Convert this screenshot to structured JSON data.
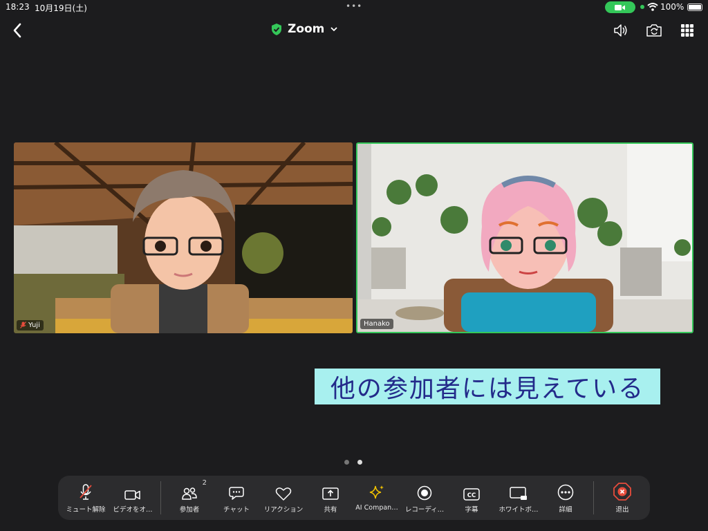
{
  "status_bar": {
    "time": "18:23",
    "date": "10月19日(土)",
    "battery": "100%"
  },
  "top_bar": {
    "meeting_title": "Zoom",
    "icons": [
      "back-chevron-icon",
      "shield-check-icon",
      "chevron-down-icon",
      "speaker-icon",
      "switch-camera-icon",
      "grid-view-icon"
    ],
    "accent_color": "#34c759"
  },
  "participants": [
    {
      "name": "Yuji",
      "muted": true
    },
    {
      "name": "Hanako",
      "muted": false,
      "active_speaker": true
    }
  ],
  "caption_text": "他の参加者には見えている",
  "toolbar": {
    "items": [
      {
        "id": "mute",
        "label": "ミュート解除",
        "icon": "mic-off-icon"
      },
      {
        "id": "video",
        "label": "ビデオをオ…",
        "icon": "video-camera-icon"
      },
      {
        "id": "participants",
        "label": "参加者",
        "icon": "participants-icon",
        "badge": "2"
      },
      {
        "id": "chat",
        "label": "チャット",
        "icon": "chat-icon"
      },
      {
        "id": "reaction",
        "label": "リアクション",
        "icon": "heart-icon"
      },
      {
        "id": "share",
        "label": "共有",
        "icon": "share-screen-icon"
      },
      {
        "id": "ai",
        "label": "AI Compan…",
        "icon": "sparkle-icon"
      },
      {
        "id": "record",
        "label": "レコーディ…",
        "icon": "record-icon"
      },
      {
        "id": "cc",
        "label": "字幕",
        "icon": "closed-caption-icon"
      },
      {
        "id": "whiteboard",
        "label": "ホワイトボ…",
        "icon": "whiteboard-icon"
      },
      {
        "id": "more",
        "label": "詳細",
        "icon": "more-icon"
      },
      {
        "id": "leave",
        "label": "退出",
        "icon": "leave-icon"
      }
    ]
  }
}
